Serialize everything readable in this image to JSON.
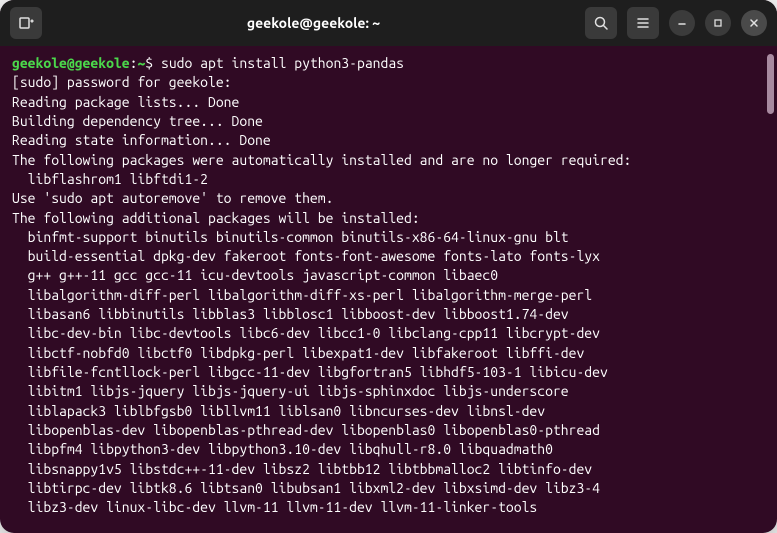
{
  "window": {
    "title": "geekole@geekole: ~"
  },
  "prompt": {
    "user_host": "geekole@geekole",
    "path": "~",
    "command": "sudo apt install python3-pandas"
  },
  "output": {
    "sudo_prompt": "[sudo] password for geekole:",
    "lines": [
      "Reading package lists... Done",
      "Building dependency tree... Done",
      "Reading state information... Done",
      "The following packages were automatically installed and are no longer required:"
    ],
    "auto_installed": "libflashrom1 libftdi1-2",
    "autoremove_hint": "Use 'sudo apt autoremove' to remove them.",
    "additional_header": "The following additional packages will be installed:",
    "additional_packages": [
      "binfmt-support binutils binutils-common binutils-x86-64-linux-gnu blt",
      "build-essential dpkg-dev fakeroot fonts-font-awesome fonts-lato fonts-lyx",
      "g++ g++-11 gcc gcc-11 icu-devtools javascript-common libaec0",
      "libalgorithm-diff-perl libalgorithm-diff-xs-perl libalgorithm-merge-perl",
      "libasan6 libbinutils libblas3 libblosc1 libboost-dev libboost1.74-dev",
      "libc-dev-bin libc-devtools libc6-dev libcc1-0 libclang-cpp11 libcrypt-dev",
      "libctf-nobfd0 libctf0 libdpkg-perl libexpat1-dev libfakeroot libffi-dev",
      "libfile-fcntllock-perl libgcc-11-dev libgfortran5 libhdf5-103-1 libicu-dev",
      "libitm1 libjs-jquery libjs-jquery-ui libjs-sphinxdoc libjs-underscore",
      "liblapack3 liblbfgsb0 libllvm11 liblsan0 libncurses-dev libnsl-dev",
      "libopenblas-dev libopenblas-pthread-dev libopenblas0 libopenblas0-pthread",
      "libpfm4 libpython3-dev libpython3.10-dev libqhull-r8.0 libquadmath0",
      "libsnappy1v5 libstdc++-11-dev libsz2 libtbb12 libtbbmalloc2 libtinfo-dev",
      "libtirpc-dev libtk8.6 libtsan0 libubsan1 libxml2-dev libxsimd-dev libz3-4",
      "libz3-dev linux-libc-dev llvm-11 llvm-11-dev llvm-11-linker-tools"
    ]
  }
}
